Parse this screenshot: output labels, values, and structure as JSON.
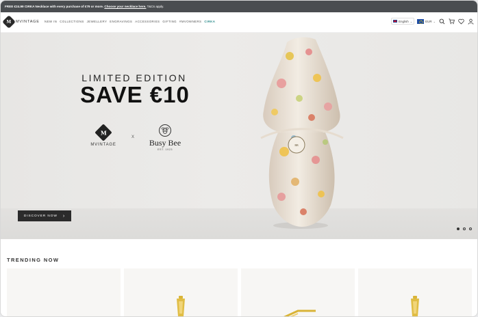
{
  "announcement": {
    "prefix": "FREE €24.99 CIRKA Necklace with every purchase of €79 or more.",
    "link": "Choose your necklace here.",
    "suffix": "T&Cs apply."
  },
  "brand": {
    "logo_letter": "M",
    "name": "MVINTAGE"
  },
  "menu": [
    "NEW IN",
    "COLLECTIONS",
    "JEWELLERY",
    "ENGRAVINGS",
    "ACCESSORIES",
    "GIFTING",
    "#MVOWNERS",
    "CIRKA"
  ],
  "header_tools": {
    "language": "English",
    "currency": "EUR"
  },
  "hero": {
    "subtitle": "LIMITED EDITION",
    "title": "SAVE €10",
    "brand_left": "MVINTAGE",
    "cross": "X",
    "brand_right_name": "Busy Bee",
    "brand_right_est": "EST. 1923",
    "cta_label": "DISCOVER NOW",
    "slide_count": 3,
    "active_slide": 1
  },
  "trending": {
    "heading": "TRENDING NOW"
  },
  "colors": {
    "announcement_bg": "#4a4d50",
    "cta_bg": "#2b2b2b",
    "accent_cirka": "#2a8a8a",
    "gold": "#d9b437"
  }
}
